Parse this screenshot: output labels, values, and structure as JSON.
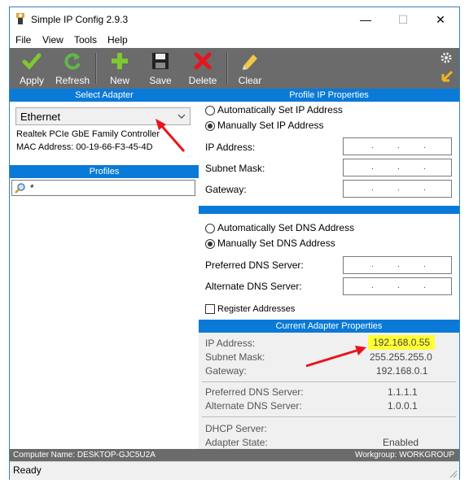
{
  "window": {
    "title": "Simple IP Config 2.9.3",
    "controls": {
      "minimize": "—",
      "maximize": "☐",
      "close": "✕"
    }
  },
  "menu": [
    "File",
    "View",
    "Tools",
    "Help"
  ],
  "toolbar": {
    "apply": "Apply",
    "refresh": "Refresh",
    "new": "New",
    "save": "Save",
    "delete": "Delete",
    "clear": "Clear"
  },
  "select_adapter": {
    "header": "Select Adapter",
    "selected": "Ethernet",
    "description": "Realtek PCIe GbE Family Controller",
    "mac": "MAC Address: 00-19-66-F3-45-4D"
  },
  "profiles": {
    "header": "Profiles",
    "search_value": "*"
  },
  "profile_ip": {
    "header": "Profile IP Properties",
    "auto_ip": "Automatically Set IP Address",
    "manual_ip": "Manually Set IP Address",
    "ip_label": "IP Address:",
    "subnet_label": "Subnet Mask:",
    "gateway_label": "Gateway:",
    "auto_dns": "Automatically Set DNS Address",
    "manual_dns": "Manually Set DNS Address",
    "pref_dns_label": "Preferred DNS Server:",
    "alt_dns_label": "Alternate DNS Server:",
    "register": "Register Addresses",
    "field_dots": "."
  },
  "current": {
    "header": "Current Adapter Properties",
    "ip_label": "IP Address:",
    "ip_value": "192.168.0.55",
    "subnet_label": "Subnet Mask:",
    "subnet_value": "255.255.255.0",
    "gateway_label": "Gateway:",
    "gateway_value": "192.168.0.1",
    "pref_dns_label": "Preferred DNS Server:",
    "pref_dns_value": "1.1.1.1",
    "alt_dns_label": "Alternate DNS Server:",
    "alt_dns_value": "1.0.0.1",
    "dhcp_label": "DHCP Server:",
    "dhcp_value": "",
    "state_label": "Adapter State:",
    "state_value": "Enabled"
  },
  "status_strip": {
    "computer": "Computer Name: DESKTOP-GJC5U2A",
    "workgroup": "Workgroup: WORKGROUP"
  },
  "status": "Ready",
  "colors": {
    "accent": "#0a7ad8",
    "toolbar": "#6b6b6b",
    "highlight": "#ffff33",
    "arrow": "#e8141c"
  }
}
